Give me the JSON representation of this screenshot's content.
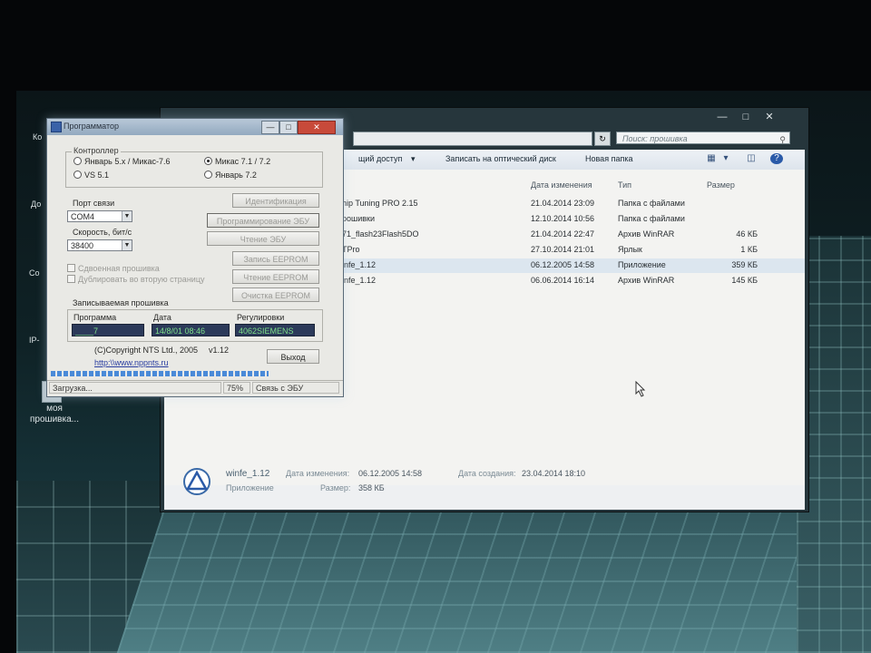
{
  "desktop": {
    "side_labels": [
      "Ко",
      "До",
      "Со",
      "IP-"
    ],
    "icon_label_line1": "моя",
    "icon_label_line2": "прошивка..."
  },
  "explorer": {
    "search_placeholder": "Поиск: прошивка",
    "toolbar": {
      "share": "щий доступ",
      "burn": "Записать на оптический диск",
      "new_folder": "Новая папка"
    },
    "columns": {
      "name": "",
      "date": "Дата изменения",
      "type": "Тип",
      "size": "Размер"
    },
    "files": [
      {
        "name": "hip Tuning PRO 2.15",
        "date": "21.04.2014 23:09",
        "type": "Папка с файлами",
        "size": ""
      },
      {
        "name": "рошивки",
        "date": "12.10.2014 10:56",
        "type": "Папка с файлами",
        "size": ""
      },
      {
        "name": "71_flash23Flash5DO",
        "date": "21.04.2014 22:47",
        "type": "Архив WinRAR",
        "size": "46 КБ"
      },
      {
        "name": "TPro",
        "date": "27.10.2014 21:01",
        "type": "Ярлык",
        "size": "1 КБ"
      },
      {
        "name": "infe_1.12",
        "date": "06.12.2005 14:58",
        "type": "Приложение",
        "size": "359 КБ"
      },
      {
        "name": "infe_1.12",
        "date": "06.06.2014 16:14",
        "type": "Архив WinRAR",
        "size": "145 КБ"
      }
    ],
    "selected_index": 4,
    "details": {
      "name": "winfe_1.12",
      "type": "Приложение",
      "modified_label": "Дата изменения:",
      "modified_value": "06.12.2005 14:58",
      "created_label": "Дата создания:",
      "created_value": "23.04.2014 18:10",
      "size_label": "Размер:",
      "size_value": "358 КБ"
    }
  },
  "programmator": {
    "title": "Программатор",
    "controller_group": "Контроллер",
    "radios": [
      {
        "label": "Январь 5.x / Микас-7.6",
        "checked": false
      },
      {
        "label": "VS 5.1",
        "checked": false
      },
      {
        "label": "Микас 7.1 / 7.2",
        "checked": true
      },
      {
        "label": "Январь 7.2",
        "checked": false
      }
    ],
    "port_label": "Порт связи",
    "port_value": "COM4",
    "speed_label": "Скорость, бит/с",
    "speed_value": "38400",
    "buttons": {
      "identify": "Идентификация",
      "program": "Программирование ЭБУ",
      "read": "Чтение ЭБУ",
      "write_eeprom": "Запись EEPROM",
      "read_eeprom": "Чтение EEPROM",
      "clear_eeprom": "Очистка EEPROM",
      "exit": "Выход"
    },
    "checkboxes": {
      "double": "Сдвоенная прошивка",
      "duplicate": "Дублировать во вторую страницу"
    },
    "firmware_group": "Записываемая прошивка",
    "firmware_headers": {
      "program": "Программа",
      "date": "Дата",
      "calibration": "Регулировки"
    },
    "firmware_values": {
      "program": "____7",
      "date": "14/8/01 08:46",
      "calibration": "4062SIEMENS"
    },
    "copyright": "(C)Copyright NTS Ltd., 2005",
    "version": "v1.12",
    "website": "http:\\\\www.nppnts.ru",
    "status": {
      "state": "Загрузка...",
      "percent": "75%",
      "connection": "Связь с ЭБУ"
    },
    "progress": 0.75
  }
}
